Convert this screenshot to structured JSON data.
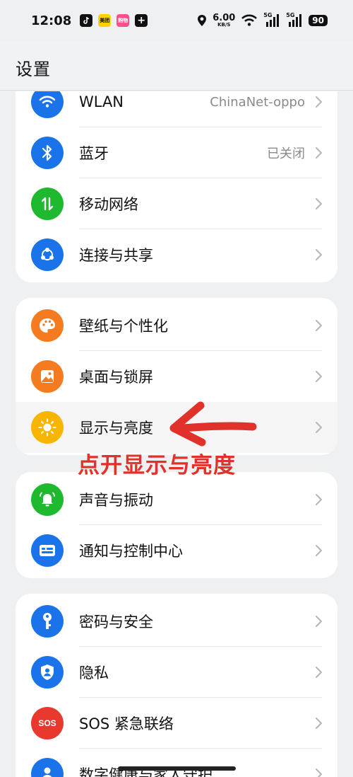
{
  "status_bar": {
    "time": "12:08",
    "net_speed_value": "6.00",
    "net_speed_unit": "KB/S",
    "signal1_label": "5G",
    "signal2_label": "5G",
    "battery": "90",
    "app_icons": [
      "tiktok-icon",
      "meituan-icon",
      "app-icon",
      "plus-icon"
    ]
  },
  "header": {
    "title": "设置"
  },
  "groups": [
    {
      "items": [
        {
          "label": "WLAN",
          "value": "ChinaNet-oppo",
          "icon": "wifi-icon",
          "color": "#1a73e8"
        },
        {
          "label": "蓝牙",
          "value": "已关闭",
          "icon": "bluetooth-icon",
          "color": "#1a73e8"
        },
        {
          "label": "移动网络",
          "value": "",
          "icon": "mobile-data-icon",
          "color": "#1fb92f"
        },
        {
          "label": "连接与共享",
          "value": "",
          "icon": "share-icon",
          "color": "#1a73e8"
        }
      ]
    },
    {
      "items": [
        {
          "label": "壁纸与个性化",
          "value": "",
          "icon": "palette-icon",
          "color": "#f47b20"
        },
        {
          "label": "桌面与锁屏",
          "value": "",
          "icon": "wallpaper-icon",
          "color": "#f47b20"
        },
        {
          "label": "显示与亮度",
          "value": "",
          "icon": "brightness-icon",
          "color": "#f7b500"
        }
      ]
    },
    {
      "items": [
        {
          "label": "声音与振动",
          "value": "",
          "icon": "bell-icon",
          "color": "#1fb92f"
        },
        {
          "label": "通知与控制中心",
          "value": "",
          "icon": "notification-icon",
          "color": "#1a73e8"
        }
      ]
    },
    {
      "items": [
        {
          "label": "密码与安全",
          "value": "",
          "icon": "key-icon",
          "color": "#1a73e8"
        },
        {
          "label": "隐私",
          "value": "",
          "icon": "privacy-icon",
          "color": "#1a73e8"
        },
        {
          "label": "SOS 紧急联络",
          "value": "",
          "icon": "sos-icon",
          "color": "#e8392f",
          "icon_text": "SOS"
        },
        {
          "label": "数字健康与家人守护",
          "value": "",
          "icon": "person-icon",
          "color": "#1a73e8"
        }
      ]
    }
  ],
  "annotation": {
    "text": "点开显示与亮度",
    "color": "#e0322a"
  }
}
